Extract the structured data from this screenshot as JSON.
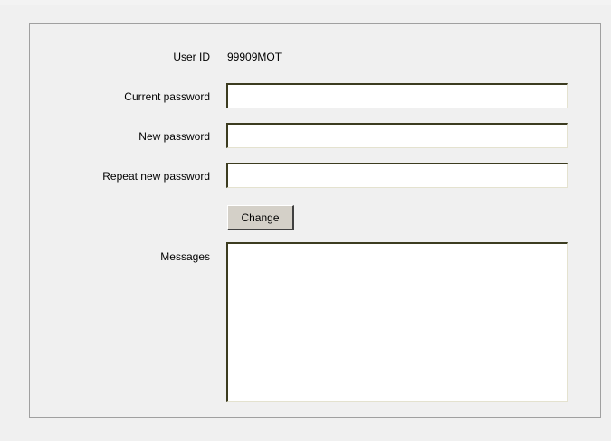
{
  "form": {
    "user_id_label": "User ID",
    "user_id_value": "99909MOT",
    "current_password_label": "Current password",
    "current_password_value": "",
    "new_password_label": "New password",
    "new_password_value": "",
    "repeat_password_label": "Repeat new password",
    "repeat_password_value": "",
    "change_button_label": "Change",
    "messages_label": "Messages",
    "messages_value": ""
  }
}
